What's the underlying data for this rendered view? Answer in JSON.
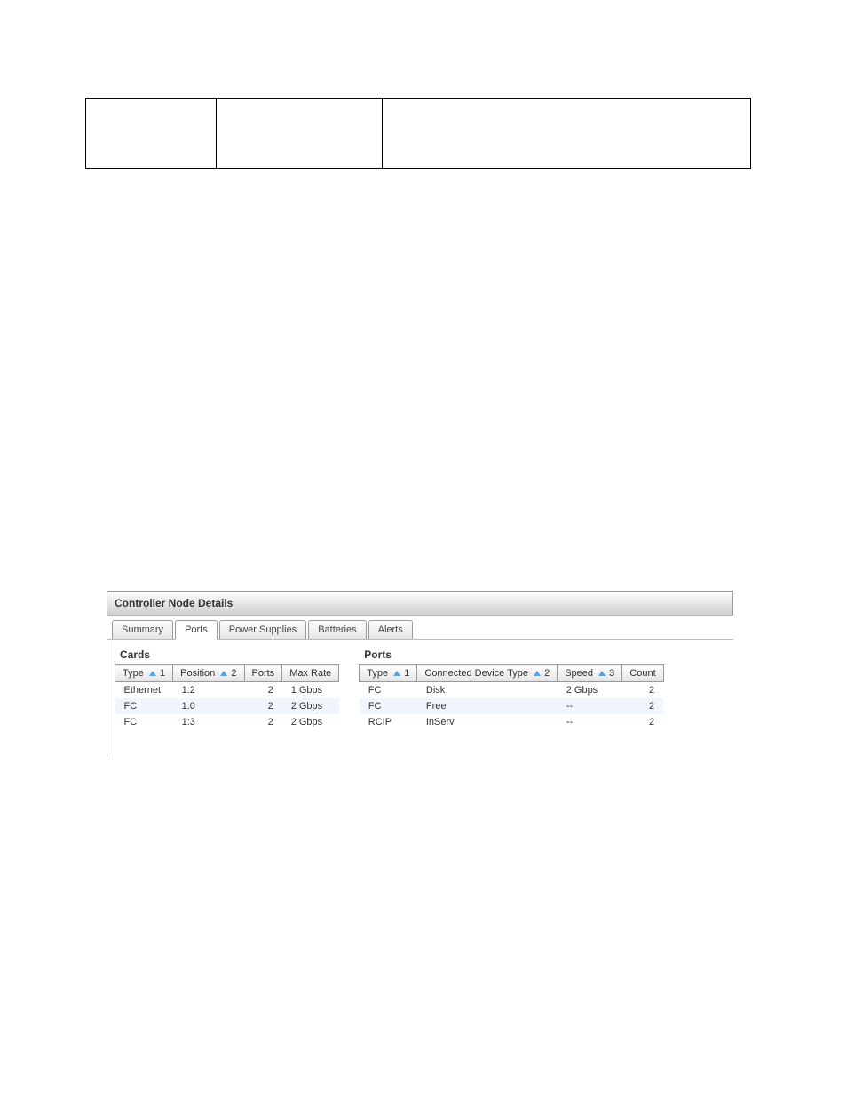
{
  "links": {
    "l1": " ",
    "l2": " ",
    "l3": " ",
    "l4": " ",
    "l5": " "
  },
  "panel": {
    "title": "Controller Node Details",
    "tabs": [
      "Summary",
      "Ports",
      "Power Supplies",
      "Batteries",
      "Alerts"
    ],
    "active_tab_index": 1
  },
  "cards": {
    "section_title": "Cards",
    "headers": {
      "type": "Type",
      "position": "Position",
      "ports": "Ports",
      "max_rate": "Max Rate"
    },
    "sort": {
      "type_order": "1",
      "position_order": "2"
    },
    "rows": [
      {
        "type": "Ethernet",
        "position": "1:2",
        "ports": "2",
        "max_rate": "1 Gbps"
      },
      {
        "type": "FC",
        "position": "1:0",
        "ports": "2",
        "max_rate": "2 Gbps"
      },
      {
        "type": "FC",
        "position": "1:3",
        "ports": "2",
        "max_rate": "2 Gbps"
      }
    ]
  },
  "ports": {
    "section_title": "Ports",
    "headers": {
      "type": "Type",
      "connected_device_type": "Connected Device Type",
      "speed": "Speed",
      "count": "Count"
    },
    "sort": {
      "type_order": "1",
      "cdt_order": "2",
      "speed_order": "3"
    },
    "rows": [
      {
        "type": "FC",
        "cdt": "Disk",
        "speed": "2 Gbps",
        "count": "2"
      },
      {
        "type": "FC",
        "cdt": "Free",
        "speed": "--",
        "count": "2"
      },
      {
        "type": "RCIP",
        "cdt": "InServ",
        "speed": "--",
        "count": "2"
      }
    ]
  }
}
